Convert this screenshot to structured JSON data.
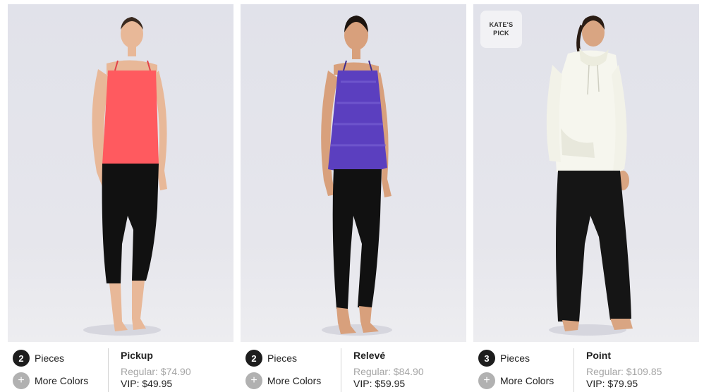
{
  "products": [
    {
      "name": "Pickup",
      "pieces_count": "2",
      "pieces_label": "Pieces",
      "more_colors_icon": "+",
      "more_colors_label": "More Colors",
      "regular_price": "Regular: $74.90",
      "vip_price": "VIP: $49.95",
      "badge": null,
      "top_color": "#ff5a5f",
      "bottom_color": "#111111"
    },
    {
      "name": "Relevé",
      "pieces_count": "2",
      "pieces_label": "Pieces",
      "more_colors_icon": "+",
      "more_colors_label": "More Colors",
      "regular_price": "Regular: $84.90",
      "vip_price": "VIP: $59.95",
      "badge": null,
      "top_color": "#5b3fbf",
      "bottom_color": "#111111"
    },
    {
      "name": "Point",
      "pieces_count": "3",
      "pieces_label": "Pieces",
      "more_colors_icon": "+",
      "more_colors_label": "More Colors",
      "regular_price": "Regular: $109.85",
      "vip_price": "VIP: $79.95",
      "badge": {
        "line1": "KATE'S",
        "line2": "PICK"
      },
      "top_color": "#f6f6ee",
      "bottom_color": "#151515"
    }
  ]
}
